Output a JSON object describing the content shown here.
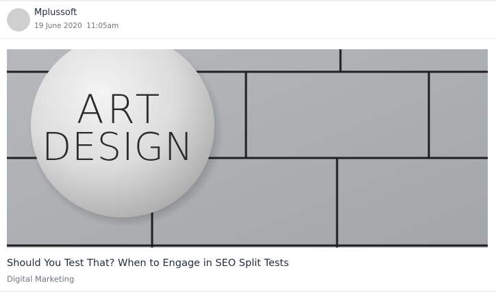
{
  "post": {
    "author": "Mplussoft",
    "timestamp": "19 June 2020  11:05am",
    "image": {
      "description_icon": "art-design-sign-photo",
      "sign_line1": "ART",
      "sign_line2": "DESIGN"
    },
    "title": "Should You Test That? When to Engage in SEO Split Tests",
    "category": "Digital Marketing"
  }
}
